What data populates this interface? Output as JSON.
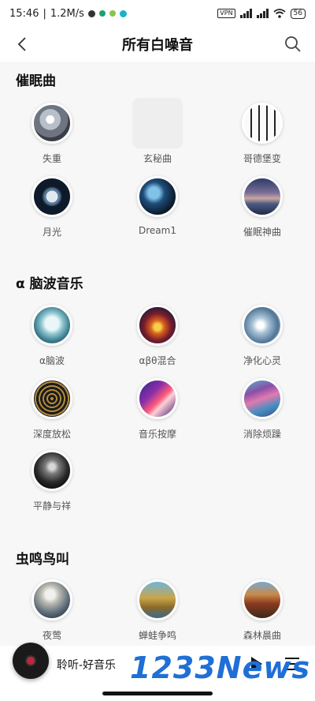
{
  "status": {
    "time": "15:46",
    "speed": "1.2M/s",
    "vpn": "VPN",
    "battery": "56"
  },
  "header": {
    "title": "所有白噪音"
  },
  "sections": [
    {
      "title": "催眠曲",
      "items": [
        {
          "label": "失重",
          "thumb": "astronaut"
        },
        {
          "label": "玄秘曲",
          "thumb": "placeholder"
        },
        {
          "label": "哥德堡变",
          "thumb": "piano"
        },
        {
          "label": "月光",
          "thumb": "moon"
        },
        {
          "label": "Dream1",
          "thumb": "dream"
        },
        {
          "label": "催眠神曲",
          "thumb": "lake"
        }
      ]
    },
    {
      "title": "α 脑波音乐",
      "items": [
        {
          "label": "α脑波",
          "thumb": "brain"
        },
        {
          "label": "αβθ混合",
          "thumb": "fire"
        },
        {
          "label": "净化心灵",
          "thumb": "water"
        },
        {
          "label": "深度放松",
          "thumb": "mandala"
        },
        {
          "label": "音乐按摩",
          "thumb": "light"
        },
        {
          "label": "消除烦躁",
          "thumb": "fluid"
        },
        {
          "label": "平静与祥",
          "thumb": "smoke"
        }
      ]
    },
    {
      "title": "虫鸣鸟叫",
      "items": [
        {
          "label": "夜莺",
          "thumb": "bird"
        },
        {
          "label": "蝉蛙争鸣",
          "thumb": "frog"
        },
        {
          "label": "森林晨曲",
          "thumb": "forest"
        }
      ]
    }
  ],
  "player": {
    "title": "聆听-好音乐"
  },
  "watermark": "1233News"
}
